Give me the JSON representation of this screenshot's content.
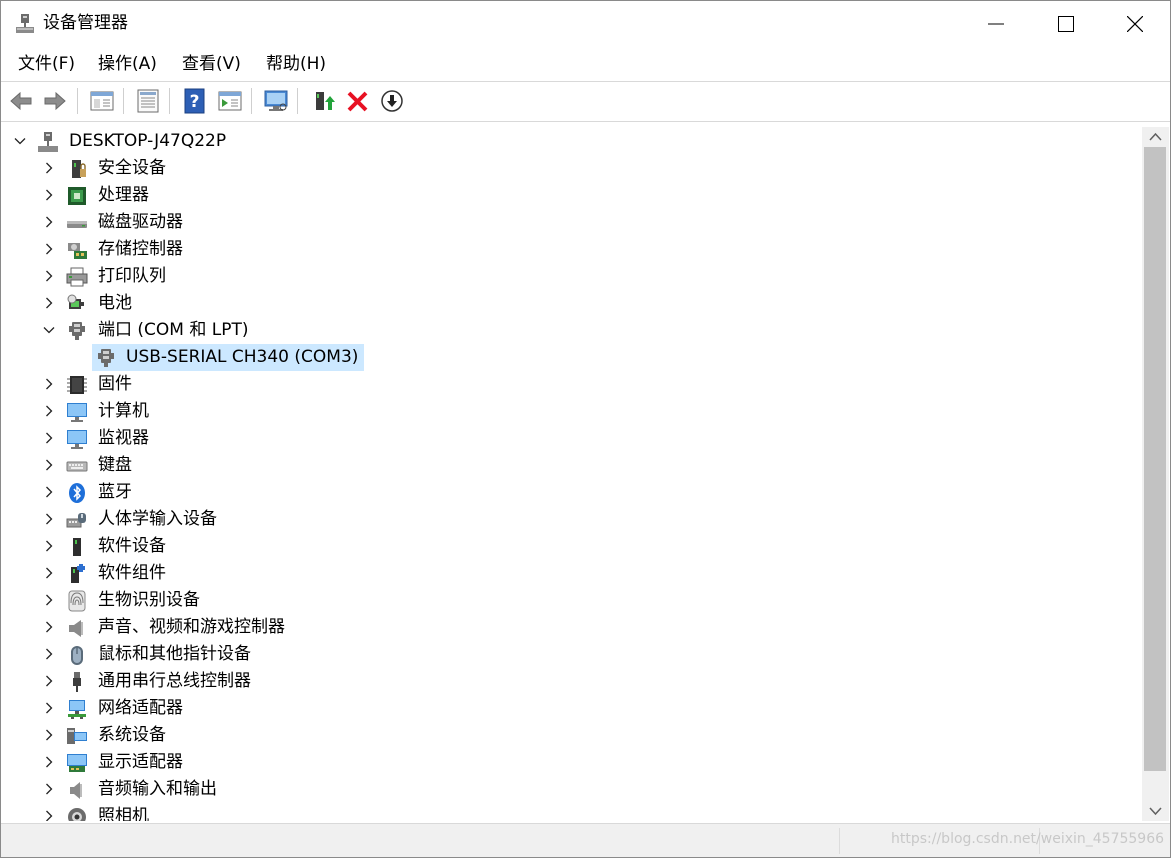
{
  "window": {
    "title": "设备管理器",
    "icon": "device-manager-icon"
  },
  "menu": [
    {
      "label": "文件(F)"
    },
    {
      "label": "操作(A)"
    },
    {
      "label": "查看(V)"
    },
    {
      "label": "帮助(H)"
    }
  ],
  "toolbar": {
    "buttons": [
      "back-arrow-icon",
      "forward-arrow-icon",
      "show-hide-tree-icon",
      "properties-icon",
      "help-icon",
      "run-action-icon",
      "scan-hardware-icon",
      "update-driver-icon",
      "uninstall-device-icon",
      "disable-device-icon"
    ]
  },
  "tree": {
    "root": {
      "label": "DESKTOP-J47Q22P",
      "icon": "computer-icon",
      "expanded": true
    },
    "categories": [
      {
        "label": "安全设备",
        "icon": "security-device-icon"
      },
      {
        "label": "处理器",
        "icon": "processor-icon"
      },
      {
        "label": "磁盘驱动器",
        "icon": "disk-drive-icon"
      },
      {
        "label": "存储控制器",
        "icon": "storage-controller-icon"
      },
      {
        "label": "打印队列",
        "icon": "printer-icon"
      },
      {
        "label": "电池",
        "icon": "battery-icon"
      },
      {
        "label": "端口 (COM 和 LPT)",
        "icon": "port-icon",
        "expanded": true
      },
      {
        "label": "固件",
        "icon": "firmware-icon"
      },
      {
        "label": "计算机",
        "icon": "monitor-icon"
      },
      {
        "label": "监视器",
        "icon": "monitor-icon"
      },
      {
        "label": "键盘",
        "icon": "keyboard-icon"
      },
      {
        "label": "蓝牙",
        "icon": "bluetooth-icon"
      },
      {
        "label": "人体学输入设备",
        "icon": "hid-icon"
      },
      {
        "label": "软件设备",
        "icon": "software-device-icon"
      },
      {
        "label": "软件组件",
        "icon": "software-component-icon"
      },
      {
        "label": "生物识别设备",
        "icon": "fingerprint-icon"
      },
      {
        "label": "声音、视频和游戏控制器",
        "icon": "speaker-icon"
      },
      {
        "label": "鼠标和其他指针设备",
        "icon": "mouse-icon"
      },
      {
        "label": "通用串行总线控制器",
        "icon": "usb-icon"
      },
      {
        "label": "网络适配器",
        "icon": "network-adapter-icon"
      },
      {
        "label": "系统设备",
        "icon": "system-device-icon"
      },
      {
        "label": "显示适配器",
        "icon": "display-adapter-icon"
      },
      {
        "label": "音频输入和输出",
        "icon": "audio-io-icon"
      },
      {
        "label": "照相机",
        "icon": "camera-icon"
      }
    ],
    "port_child": {
      "label": "USB-SERIAL CH340 (COM3)",
      "icon": "port-icon",
      "selected": true
    }
  },
  "statusbar": {
    "watermark": "https://blog.csdn.net/weixin_45755966"
  },
  "colors": {
    "selection": "#cce8ff",
    "scroll_thumb": "#c2c2c2",
    "uninstall_red": "#e81123"
  }
}
